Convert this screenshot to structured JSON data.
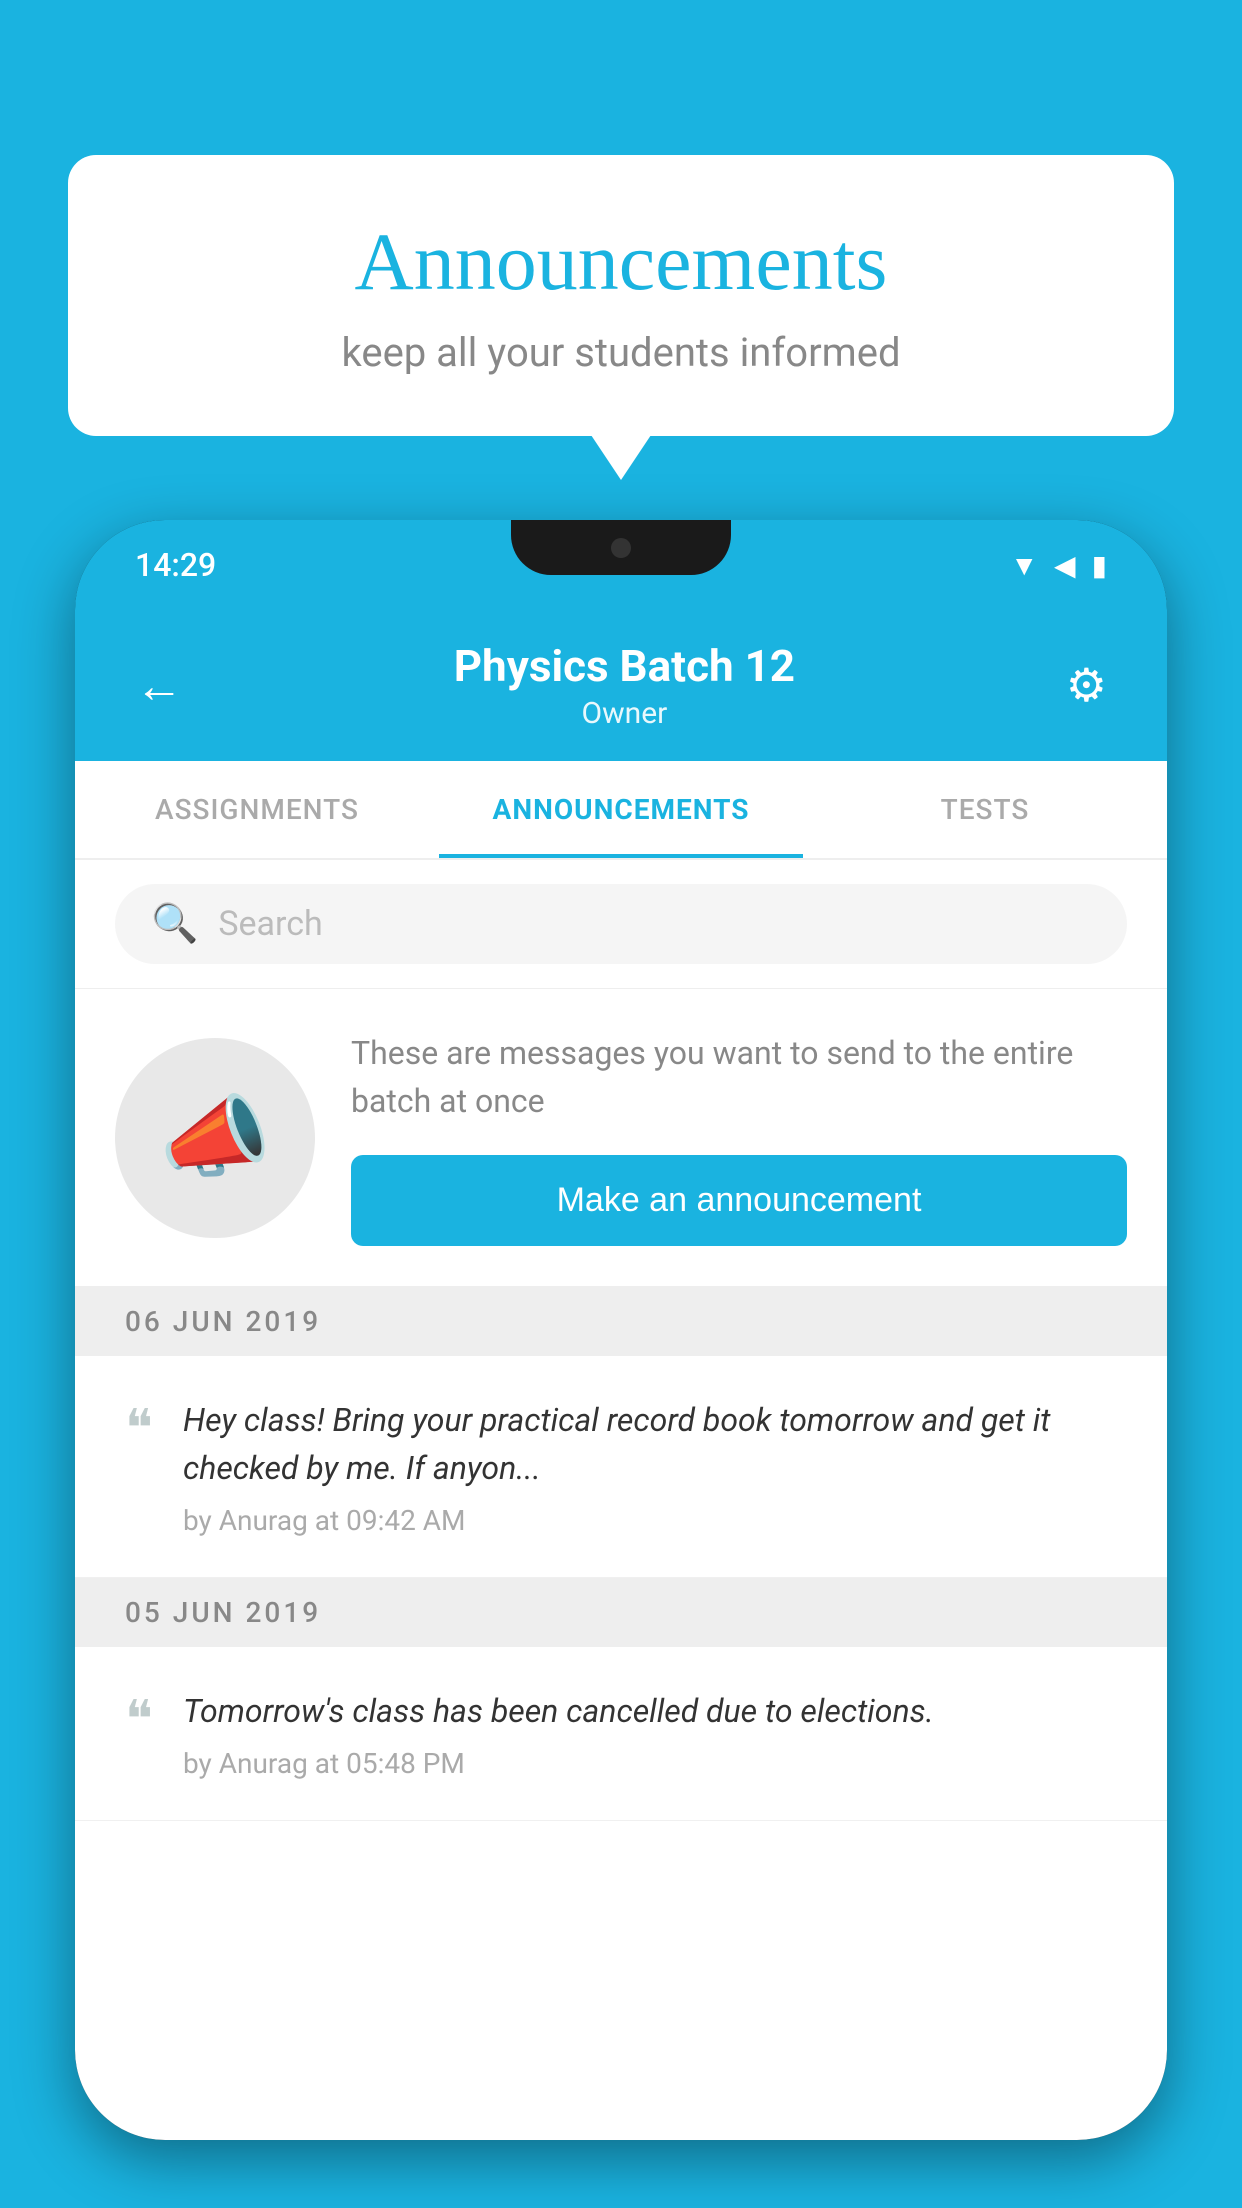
{
  "background_color": "#1ab3e0",
  "speech_bubble": {
    "title": "Announcements",
    "subtitle": "keep all your students informed"
  },
  "phone": {
    "status_bar": {
      "time": "14:29"
    },
    "header": {
      "title": "Physics Batch 12",
      "subtitle": "Owner",
      "back_label": "←",
      "gear_label": "⚙"
    },
    "tabs": [
      {
        "label": "ASSIGNMENTS",
        "active": false
      },
      {
        "label": "ANNOUNCEMENTS",
        "active": true
      },
      {
        "label": "TESTS",
        "active": false
      }
    ],
    "search": {
      "placeholder": "Search"
    },
    "promo": {
      "description": "These are messages you want to send to the entire batch at once",
      "button_label": "Make an announcement"
    },
    "announcements": [
      {
        "date": "06  JUN  2019",
        "text": "Hey class! Bring your practical record book tomorrow and get it checked by me. If anyon...",
        "meta": "by Anurag at 09:42 AM"
      },
      {
        "date": "05  JUN  2019",
        "text": "Tomorrow's class has been cancelled due to elections.",
        "meta": "by Anurag at 05:48 PM"
      }
    ]
  }
}
